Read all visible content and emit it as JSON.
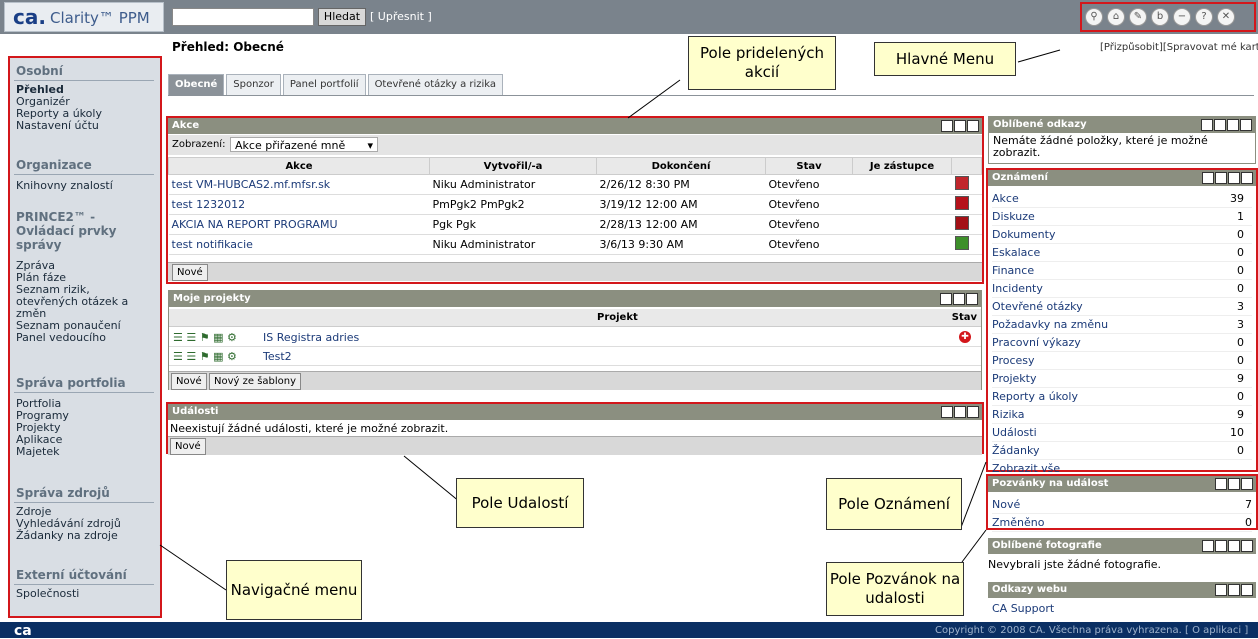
{
  "header": {
    "logo_ca": "ca.",
    "logo_brand": "Clarity™ PPM",
    "search_button": "Hledat",
    "refine_link": "[ Upřesnit ]",
    "toolbar_icons": [
      "search-icon",
      "home-icon",
      "edit-icon",
      "b-icon",
      "minus-icon",
      "help-icon",
      "close-icon"
    ]
  },
  "page": {
    "title": "Přehled: Obecné",
    "customize": "[Přizpůsobit][Spravovat mé karty]"
  },
  "tabs": [
    "Obecné",
    "Sponzor",
    "Panel portfolií",
    "Otevřené otázky a rizika"
  ],
  "nav": {
    "osobni": {
      "title": "Osobní",
      "items": [
        "Přehled",
        "Organizér",
        "Reporty a úkoly",
        "Nastavení účtu"
      ]
    },
    "organizace": {
      "title": "Organizace",
      "items": [
        "Knihovny znalostí"
      ]
    },
    "prince": {
      "title_lines": [
        "PRINCE2™ -",
        "Ovládací prvky",
        "správy"
      ],
      "items": [
        "Zpráva",
        "Plán fáze",
        "Seznam rizik,",
        "otevřených otázek a",
        "změn",
        "Seznam ponaučení",
        "Panel vedoucího"
      ]
    },
    "portfolio": {
      "title": "Správa portfolia",
      "items": [
        "Portfolia",
        "Programy",
        "Projekty",
        "Aplikace",
        "Majetek"
      ]
    },
    "zdroje": {
      "title": "Správa zdrojů",
      "items": [
        "Zdroje",
        "Vyhledávání zdrojů",
        "Žádanky na zdroje"
      ]
    },
    "externi": {
      "title": "Externí účtování",
      "items": [
        "Společnosti"
      ]
    }
  },
  "akce": {
    "title": "Akce",
    "filter_label": "Zobrazení:",
    "filter_value": "Akce přiřazené mně",
    "columns": [
      "Akce",
      "Vytvořil/-a",
      "Dokončení",
      "Stav",
      "Je zástupce"
    ],
    "rows": [
      {
        "name": "test VM-HUBCAS2.mf.mfsr.sk",
        "by": "Niku Administrator",
        "due": "2/26/12 8:30 PM",
        "stav": "Otevřeno",
        "color": "#c0262c"
      },
      {
        "name": "test 1232012",
        "by": "PmPgk2 PmPgk2",
        "due": "3/19/12 12:00 AM",
        "stav": "Otevřeno",
        "color": "#b5121b"
      },
      {
        "name": "AKCIA NA REPORT PROGRAMU",
        "by": "Pgk Pgk",
        "due": "2/28/13 12:00 AM",
        "stav": "Otevřeno",
        "color": "#a31016"
      },
      {
        "name": "test notifikacie",
        "by": "Niku Administrator",
        "due": "3/6/13 9:30 AM",
        "stav": "Otevřeno",
        "color": "#3d8f2a"
      }
    ],
    "new_button": "Nové"
  },
  "projekty": {
    "title": "Moje projekty",
    "col_projekt": "Projekt",
    "col_stav": "Stav",
    "rows": [
      {
        "name": "IS Registra adries",
        "status": "warning"
      },
      {
        "name": "Test2",
        "status": ""
      }
    ],
    "new_button": "Nové",
    "template_button": "Nový ze šablony"
  },
  "udalosti": {
    "title": "Události",
    "empty": "Neexistují žádné události, které je možné zobrazit.",
    "new_button": "Nové"
  },
  "oblibene_odkazy": {
    "title": "Oblíbené odkazy",
    "empty": "Nemáte žádné položky, které je možné zobrazit."
  },
  "oznameni": {
    "title": "Oznámení",
    "rows": [
      {
        "label": "Akce",
        "value": "39"
      },
      {
        "label": "Diskuze",
        "value": "1"
      },
      {
        "label": "Dokumenty",
        "value": "0"
      },
      {
        "label": "Eskalace",
        "value": "0"
      },
      {
        "label": "Finance",
        "value": "0"
      },
      {
        "label": "Incidenty",
        "value": "0"
      },
      {
        "label": "Otevřené otázky",
        "value": "3"
      },
      {
        "label": "Požadavky na změnu",
        "value": "3"
      },
      {
        "label": "Pracovní výkazy",
        "value": "0"
      },
      {
        "label": "Procesy",
        "value": "0"
      },
      {
        "label": "Projekty",
        "value": "9"
      },
      {
        "label": "Reporty a úkoly",
        "value": "0"
      },
      {
        "label": "Rizika",
        "value": "9"
      },
      {
        "label": "Události",
        "value": "10"
      },
      {
        "label": "Žádanky",
        "value": "0"
      }
    ],
    "show_all": "Zobrazit vše"
  },
  "pozvanky": {
    "title": "Pozvánky na událost",
    "rows": [
      {
        "label": "Nové",
        "value": "7"
      },
      {
        "label": "Změněno",
        "value": "0"
      }
    ]
  },
  "fotografie": {
    "title": "Oblíbené fotografie",
    "empty": "Nevybrali jste žádné fotografie."
  },
  "odkazy_webu": {
    "title": "Odkazy webu",
    "link": "CA Support"
  },
  "callouts": {
    "pole_akci": "Pole pridelených akcií",
    "hlavne_menu": "Hlavné Menu",
    "navigacne_menu": "Navigačné menu",
    "pole_udalosti": "Pole Udalostí",
    "pole_oznameni": "Pole Oznámení",
    "pole_pozvanok": "Pole Pozvánok na udalosti"
  },
  "footer": {
    "ca": "ca",
    "copyright": "Copyright © 2008 CA. Všechna práva vyhrazena. [ O aplikaci ]"
  }
}
